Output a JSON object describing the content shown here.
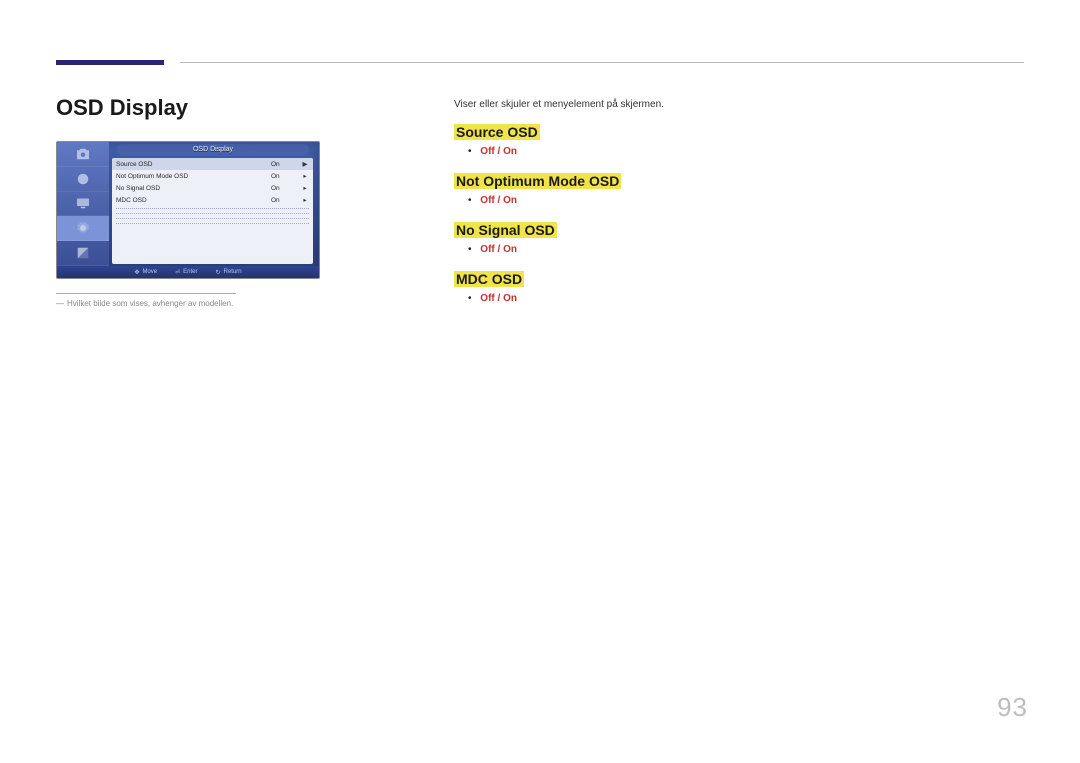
{
  "page_number": "93",
  "section_title": "OSD Display",
  "annotation": "Hvilket bilde som vises, avhenger av modellen.",
  "intro": "Viser eller skjuler et menyelement på skjermen.",
  "osd": {
    "panel_title": "OSD Display",
    "rows": [
      {
        "label": "Source OSD",
        "value": "On"
      },
      {
        "label": "Not Optimum Mode OSD",
        "value": "On"
      },
      {
        "label": "No Signal OSD",
        "value": "On"
      },
      {
        "label": "MDC OSD",
        "value": "On"
      }
    ],
    "bottom": {
      "move": "Move",
      "enter": "Enter",
      "return": "Return"
    }
  },
  "options": {
    "off": "Off",
    "on": "On"
  },
  "headings": {
    "source": "Source OSD",
    "not_optimum": "Not Optimum Mode OSD",
    "no_signal": "No Signal OSD",
    "mdc": "MDC OSD"
  }
}
